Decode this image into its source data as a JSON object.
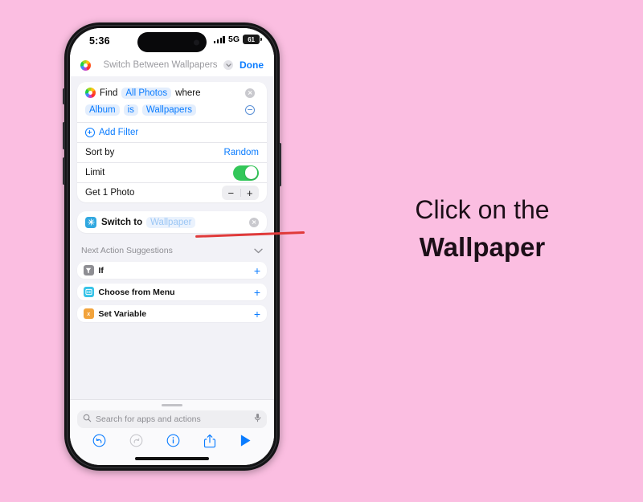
{
  "page": {
    "background_color": "#fbbee1",
    "caption_line_1": "Click on the",
    "caption_line_2": "Wallpaper"
  },
  "pointer": {
    "name": "red-arrow-line",
    "color": "#e03a3a"
  },
  "phone": {
    "status_bar": {
      "time": "5:36",
      "network": "5G",
      "battery_level": "61",
      "signal_icon": "cellular-bars-icon",
      "dynamic_island": "dynamic-island"
    },
    "header": {
      "app_icon": "photos-app-icon",
      "title": "Switch Between Wallpapers",
      "chevron_icon": "chevron-down-icon",
      "done_label": "Done"
    }
  },
  "find_card": {
    "icon": "photos-app-icon",
    "verb": "Find",
    "target": "All Photos",
    "where": "where",
    "close_icon": "close-circle-icon",
    "filter": {
      "field": "Album",
      "operator": "is",
      "value": "Wallpapers",
      "remove_icon": "minus-circle-icon"
    },
    "add_filter": {
      "icon": "plus-circle-icon",
      "label": "Add Filter"
    },
    "sort": {
      "label": "Sort by",
      "value": "Random"
    },
    "limit": {
      "label": "Limit",
      "toggle_on": true,
      "toggle_color": "#33c759"
    },
    "get_photo": {
      "label": "Get 1 Photo",
      "minus_label": "−",
      "plus_label": "+"
    }
  },
  "switch_card": {
    "icon": "wallpaper-icon",
    "label": "Switch to",
    "value": "Wallpaper",
    "close_icon": "close-circle-icon"
  },
  "suggestions": {
    "header": "Next Action Suggestions",
    "chevron_icon": "chevron-down-icon",
    "items": [
      {
        "icon": "if-condition-icon",
        "label": "If",
        "add_icon": "plus-icon"
      },
      {
        "icon": "choose-from-menu-icon",
        "label": "Choose from Menu",
        "add_icon": "plus-icon"
      },
      {
        "icon": "set-variable-icon",
        "label": "Set Variable",
        "add_icon": "plus-icon"
      }
    ]
  },
  "dock": {
    "search": {
      "icon": "search-icon",
      "placeholder": "Search for apps and actions",
      "mic_icon": "microphone-icon"
    },
    "toolbar": [
      {
        "icon": "undo-icon",
        "enabled": true
      },
      {
        "icon": "redo-icon",
        "enabled": false
      },
      {
        "icon": "info-icon",
        "enabled": true
      },
      {
        "icon": "share-icon",
        "enabled": true
      },
      {
        "icon": "play-icon",
        "enabled": true
      }
    ]
  }
}
